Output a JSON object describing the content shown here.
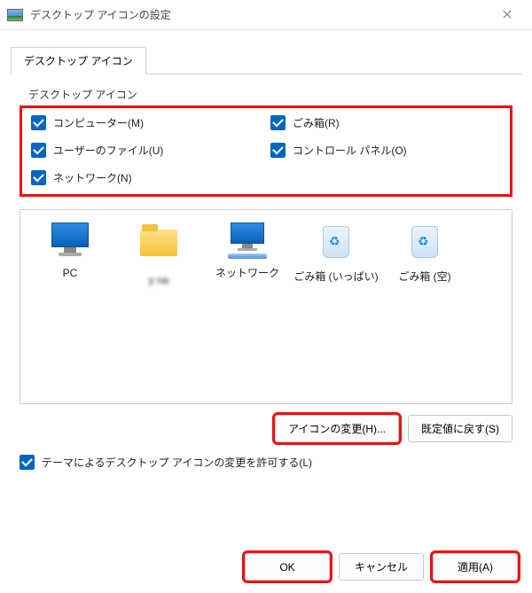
{
  "window": {
    "title": "デスクトップ アイコンの設定"
  },
  "tab": {
    "label": "デスクトップ アイコン"
  },
  "group": {
    "label": "デスクトップ アイコン"
  },
  "checks": {
    "computer": "コンピューター(M)",
    "recyclebin": "ごみ箱(R)",
    "userfiles": "ユーザーのファイル(U)",
    "controlpanel": "コントロール パネル(O)",
    "network": "ネットワーク(N)"
  },
  "icons": {
    "pc": "PC",
    "user": "y   na",
    "network": "ネットワーク",
    "bin_full": "ごみ箱\n(いっぱい)",
    "bin_empty": "ごみ箱 (空)"
  },
  "buttons": {
    "change_icon": "アイコンの変更(H)...",
    "restore_default": "既定値に戻す(S)"
  },
  "theme_check": "テーマによるデスクトップ アイコンの変更を許可する(L)",
  "footer": {
    "ok": "OK",
    "cancel": "キャンセル",
    "apply": "適用(A)"
  }
}
